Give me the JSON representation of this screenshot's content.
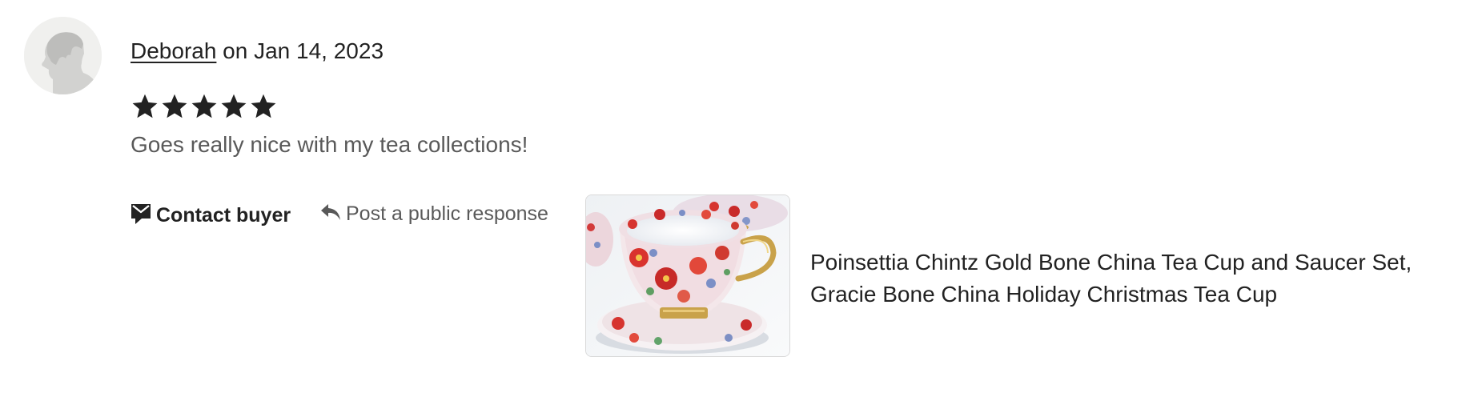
{
  "review": {
    "reviewer_name": "Deborah",
    "date_text": " on Jan 14, 2023",
    "rating": 5,
    "rating_max": 5,
    "text": "Goes really nice with my tea collections!"
  },
  "actions": {
    "contact_label": "Contact buyer",
    "respond_label": "Post a public response"
  },
  "listing": {
    "title": "Poinsettia Chintz Gold Bone China Tea Cup and Saucer Set, Gracie Bone China Holiday Christmas Tea Cup"
  },
  "icons": {
    "avatar": "default-avatar-icon",
    "star": "star-icon",
    "contact": "envelope-icon",
    "respond": "reply-arrow-icon"
  },
  "colors": {
    "text_primary": "#222222",
    "text_secondary": "#595959",
    "avatar_bg": "#f0f0ee"
  }
}
